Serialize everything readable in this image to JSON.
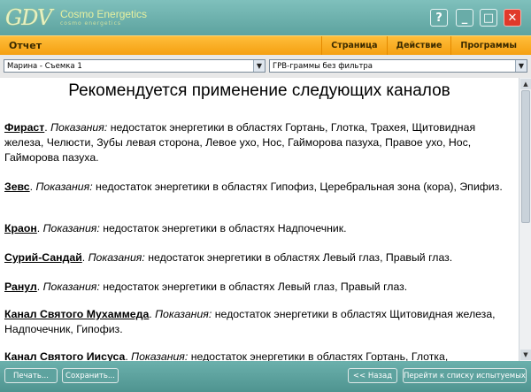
{
  "app": {
    "logo_text": "GDV",
    "brand": "Cosmo Energetics",
    "brand_sub": "cosmo energetics"
  },
  "window_buttons": {
    "help": "?",
    "minimize": "_",
    "maximize": "□",
    "close": "✕"
  },
  "menubar": {
    "title": "Отчет",
    "tabs": [
      "Страница",
      "Действие",
      "Программы"
    ]
  },
  "selectors": {
    "session": "Марина - Съемка 1",
    "filter": "ГРВ-граммы без фильтра"
  },
  "report": {
    "heading": "Рекомендуется применение следующих каналов",
    "indication_label": "Показания:",
    "entries": [
      {
        "name": "Фираст",
        "text": "недостаток энергетики в областях Гортань, Глотка, Трахея, Щитовидная железа, Челюсти, Зубы левая сторона, Левое ухо, Нос, Гайморова пазуха, Правое ухо, Нос, Гайморова пазуха."
      },
      {
        "name": "Зевс",
        "text": "недостаток энергетики в областях Гипофиз, Церебральная зона (кора), Эпифиз."
      },
      {
        "name": "Краон",
        "text": "недостаток энергетики в областях Надпочечник."
      },
      {
        "name": "Сурий-Сандай",
        "text": "недостаток энергетики в областях Левый глаз, Правый глаз."
      },
      {
        "name": "Ранул",
        "text": "недостаток энергетики в областях Левый глаз, Правый глаз."
      },
      {
        "name": "Канал Святого Мухаммеда",
        "text": "недостаток энергетики в областях Щитовидная железа, Надпочечник, Гипофиз."
      },
      {
        "name": "Канал Святого Иисуса",
        "text": "недостаток энергетики в областях Гортань, Глотка,"
      }
    ]
  },
  "bottom": {
    "print": "Печать...",
    "save": "Сохранить...",
    "back": "<< Назад",
    "goto": "Перейти к списку испытуемых"
  }
}
